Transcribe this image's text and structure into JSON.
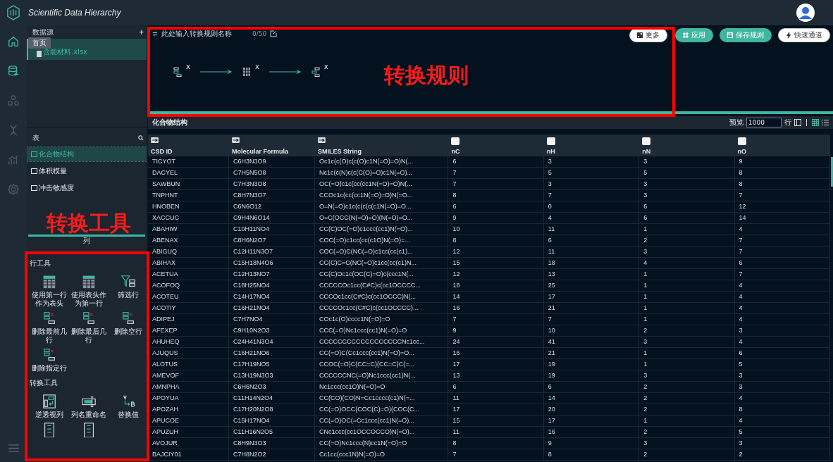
{
  "app": {
    "title": "Scientific Data Hierarchy"
  },
  "nav": [
    {
      "disabled": false
    },
    {
      "disabled": false
    },
    {
      "disabled": true
    },
    {
      "disabled": true
    },
    {
      "disabled": true
    },
    {
      "disabled": true
    }
  ],
  "tooltip": "首页",
  "sources": {
    "title": "数据源",
    "add": "+",
    "files": [
      {
        "name": "含能材料.xlsx",
        "selected": true
      }
    ]
  },
  "tables": {
    "title": "表",
    "items": [
      {
        "name": "化合物结构",
        "selected": true
      },
      {
        "name": "体积模量",
        "selected": false
      },
      {
        "name": "冲击敏感度",
        "selected": false
      }
    ]
  },
  "columns_panel": {
    "title": "列"
  },
  "tools": [
    {
      "title": "行工具",
      "items": [
        {
          "kind": "tool",
          "label": "使用第一行作为表头"
        },
        {
          "kind": "tool",
          "label": "使用表头作为第一行"
        },
        {
          "kind": "tool",
          "label": "筛选行"
        },
        {
          "kind": "tool",
          "label": "删除最前几行"
        },
        {
          "kind": "tool",
          "label": "删除最后几行"
        },
        {
          "kind": "tool",
          "label": "删除空行"
        },
        {
          "kind": "tool",
          "label": "删除指定行"
        }
      ]
    },
    {
      "title": "转换工具",
      "items": [
        {
          "kind": "tool",
          "label": "逆透视列"
        },
        {
          "kind": "tool",
          "label": "列名重命名"
        },
        {
          "kind": "tool",
          "label": "替换值"
        },
        {
          "kind": "partial"
        },
        {
          "kind": "partial"
        }
      ]
    }
  ],
  "rule": {
    "placeholder": "此处输入转换规则名称",
    "counter": "0/50",
    "steps": [
      {
        "remove": "x"
      },
      {
        "remove": "x"
      },
      {
        "remove": "x"
      }
    ]
  },
  "actions": [
    {
      "label": "更多",
      "kind": "outline"
    },
    {
      "label": "应用",
      "kind": "primary"
    },
    {
      "label": "保存规则",
      "kind": "primary"
    },
    {
      "label": "快速通道",
      "kind": "outline"
    }
  ],
  "table": {
    "title": "化合物结构",
    "preview": {
      "label": "预览",
      "value": "1000",
      "unit": "行"
    },
    "columns": [
      {
        "name": "CSD ID",
        "kind": "text"
      },
      {
        "name": "Molecular Formula",
        "kind": "text"
      },
      {
        "name": "SMILES String",
        "kind": "text"
      },
      {
        "name": "nC",
        "kind": "number"
      },
      {
        "name": "nH",
        "kind": "number"
      },
      {
        "name": "nN",
        "kind": "number"
      },
      {
        "name": "nO",
        "kind": "number"
      }
    ],
    "rows": [
      [
        "TICYOT",
        "C6H3N3O9",
        "Oc1c(c(O)c(c(O)c1N(=O)=O)N(...",
        "6",
        "3",
        "3",
        "9"
      ],
      [
        "DACYEL",
        "C7H5N5O8",
        "Nc1c(c(N)c(c(C(O)=O)c1N(=O)...",
        "7",
        "5",
        "5",
        "8"
      ],
      [
        "SAWBUN",
        "C7H3N3O8",
        "OC(=O)c1c(cc(cc1N(=O)=O)N(...",
        "7",
        "3",
        "3",
        "8"
      ],
      [
        "TNPHNT",
        "C8H7N3O7",
        "CCOc1c(cc(cc1N(=O)=O)N(=O...",
        "8",
        "7",
        "3",
        "7"
      ],
      [
        "HNOBEN",
        "C6N6O12",
        "O=N(=O)c1c(c(c(c(c1N(=O)=O...",
        "6",
        "0",
        "6",
        "12"
      ],
      [
        "XACCUC",
        "C9H4N6O14",
        "O=C(OCC(N(=O)=O)(N(=O)=O...",
        "9",
        "4",
        "6",
        "14"
      ],
      [
        "ABAHIW",
        "C10H11NO4",
        "CC(C)OC(=O)c1ccc(cc1)N(=O)...",
        "10",
        "11",
        "1",
        "4"
      ],
      [
        "ABENAX",
        "C8H6N2O7",
        "COC(=O)c1cc(cc(c1O)N(=O)=...",
        "8",
        "6",
        "2",
        "7"
      ],
      [
        "ABIGUQ",
        "C12H11N3O7",
        "COC(=O)C(NC(=O)c1cc(cc(c1)...",
        "12",
        "11",
        "3",
        "7"
      ],
      [
        "ABIHAX",
        "C15H18N4O6",
        "CC(C)C=C(NC(=O)c1cc(cc(c1)N...",
        "15",
        "18",
        "4",
        "6"
      ],
      [
        "ACETUA",
        "C12H13NO7",
        "CC(C)Oc1c(OC(C)=O)c(ccc1N(...",
        "12",
        "13",
        "1",
        "7"
      ],
      [
        "ACOFOQ",
        "C18H25NO4",
        "CCCCCOc1cc(C#C)c(cc1OCCCC...",
        "18",
        "25",
        "1",
        "4"
      ],
      [
        "ACOTEU",
        "C14H17NO4",
        "CCCOc1cc(C#C)c(cc1OCCC)N(...",
        "14",
        "17",
        "1",
        "4"
      ],
      [
        "ACOTIY",
        "C16H21NO4",
        "CCCCOc1cc(C#C)c(cc1OCCCC)...",
        "16",
        "21",
        "1",
        "4"
      ],
      [
        "ADIPEJ",
        "C7H7NO4",
        "COc1c(O)cccc1N(=O)=O",
        "7",
        "7",
        "1",
        "4"
      ],
      [
        "AFEXEP",
        "C9H10N2O3",
        "CCC(=O)Nc1ccc(cc1)N(=O)=O",
        "9",
        "10",
        "2",
        "3"
      ],
      [
        "AHUHEQ",
        "C24H41N3O4",
        "CCCCCCCCCCCCCCCCCCNc1cc...",
        "24",
        "41",
        "3",
        "4"
      ],
      [
        "AJUQUS",
        "C16H21NO6",
        "CC(=O)C(Cc1ccc(cc1)N(=O)=O...",
        "16",
        "21",
        "1",
        "6"
      ],
      [
        "ALOTUS",
        "C17H19NO5",
        "CCOC(=O)C(CC=C)(CC=C)C(=...",
        "17",
        "19",
        "1",
        "5"
      ],
      [
        "AMEVOF",
        "C13H19N3O3",
        "CCCCCCNC(=O)Nc1ccc(cc1)N(...",
        "13",
        "19",
        "3",
        "3"
      ],
      [
        "AMNPHA",
        "C6H6N2O3",
        "Nc1ccc(cc1O)N(=O)=O",
        "6",
        "6",
        "2",
        "3"
      ],
      [
        "APOYUA",
        "C11H14N2O4",
        "CC(CO)(CO)N=Cc1cccc(c1)N(=...",
        "11",
        "14",
        "2",
        "4"
      ],
      [
        "APOZAH",
        "C17H20N2O8",
        "CC(=O)OCC(COC(C)=O)(COC(C...",
        "17",
        "20",
        "2",
        "8"
      ],
      [
        "APUCOE",
        "C15H17NO4",
        "CC(=O)OC(=Cc1ccc(cc1)N(=O)...",
        "15",
        "17",
        "1",
        "4"
      ],
      [
        "APUZUH",
        "C11H16N2O5",
        "CNc1ccc(cc1OCCOCCO)N(=O)...",
        "11",
        "16",
        "2",
        "5"
      ],
      [
        "AVOJUR",
        "C8H9N3O3",
        "CC(=O)Nc1ccc(N)cc1N(=O)=O",
        "8",
        "9",
        "3",
        "3"
      ],
      [
        "BAJCIY01",
        "C7H8N2O2",
        "Cc1cc(ccc1N)N(=O)=O",
        "7",
        "8",
        "2",
        "2"
      ]
    ]
  },
  "annotations": [
    {
      "label": "转换规则"
    },
    {
      "label": "转换工具"
    }
  ]
}
